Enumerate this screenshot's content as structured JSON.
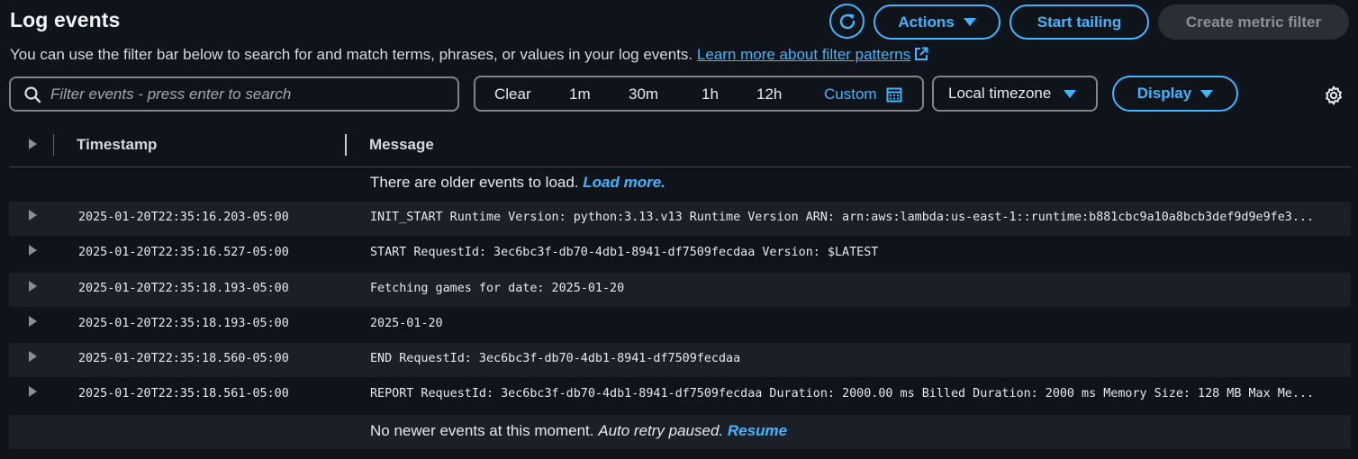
{
  "header": {
    "title": "Log events",
    "description": "You can use the filter bar below to search for and match terms, phrases, or values in your log events. ",
    "learn_more": "Learn more about filter patterns",
    "actions_label": "Actions",
    "start_tailing_label": "Start tailing",
    "create_metric_filter_label": "Create metric filter"
  },
  "filter": {
    "search_placeholder": "Filter events - press enter to search",
    "ranges": [
      "Clear",
      "1m",
      "30m",
      "1h",
      "12h"
    ],
    "custom_label": "Custom",
    "timezone_label": "Local timezone",
    "display_label": "Display"
  },
  "table": {
    "columns": [
      "Timestamp",
      "Message"
    ],
    "older_text": "There are older events to load. ",
    "older_link": "Load more.",
    "rows": [
      {
        "timestamp": "2025-01-20T22:35:16.203-05:00",
        "message": "INIT_START Runtime Version: python:3.13.v13 Runtime Version ARN: arn:aws:lambda:us-east-1::runtime:b881cbc9a10a8bcb3def9d9e9fe3..."
      },
      {
        "timestamp": "2025-01-20T22:35:16.527-05:00",
        "message": "START RequestId: 3ec6bc3f-db70-4db1-8941-df7509fecdaa Version: $LATEST"
      },
      {
        "timestamp": "2025-01-20T22:35:18.193-05:00",
        "message": "Fetching games for date: 2025-01-20"
      },
      {
        "timestamp": "2025-01-20T22:35:18.193-05:00",
        "message": "2025-01-20"
      },
      {
        "timestamp": "2025-01-20T22:35:18.560-05:00",
        "message": "END RequestId: 3ec6bc3f-db70-4db1-8941-df7509fecdaa"
      },
      {
        "timestamp": "2025-01-20T22:35:18.561-05:00",
        "message": "REPORT RequestId: 3ec6bc3f-db70-4db1-8941-df7509fecdaa Duration: 2000.00 ms Billed Duration: 2000 ms Memory Size: 128 MB Max Me..."
      }
    ],
    "newer_text": "No newer events at this moment. ",
    "newer_italic": "Auto retry paused.",
    "newer_link": "Resume"
  },
  "icons": {
    "refresh": "refresh-icon",
    "search": "search-icon",
    "calendar": "calendar-icon",
    "settings": "gear-icon",
    "external": "external-link-icon"
  },
  "colors": {
    "background": "#0f141a",
    "accent": "#42b4ff",
    "row_alt": "#1b2028",
    "disabled": "#2a2f36"
  }
}
